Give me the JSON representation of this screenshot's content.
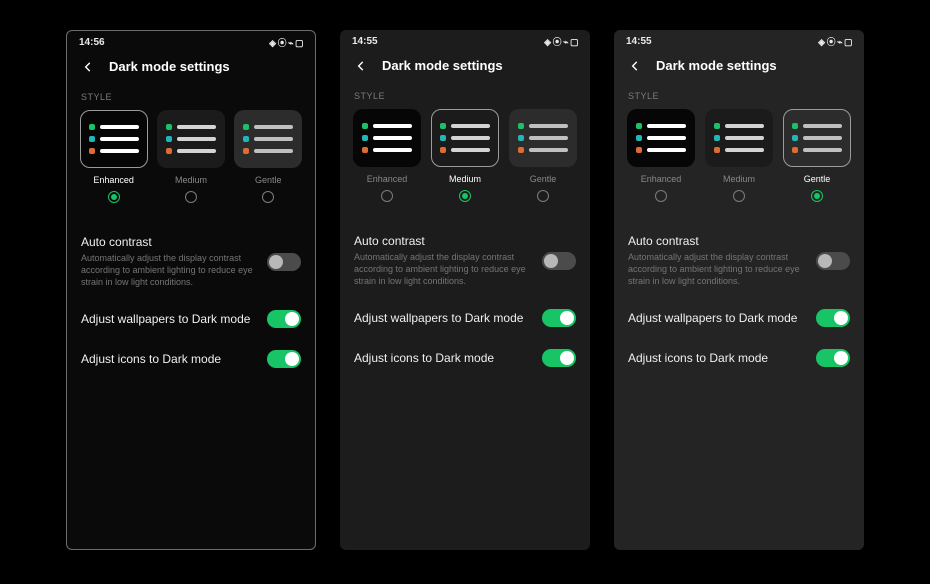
{
  "phones": [
    {
      "bg_class": "bg-enhanced",
      "framed": true,
      "time": "14:56",
      "title": "Dark mode settings",
      "section_label": "STYLE",
      "selected_index": 0,
      "styles": [
        {
          "label": "Enhanced"
        },
        {
          "label": "Medium"
        },
        {
          "label": "Gentle"
        }
      ],
      "settings": {
        "auto_contrast_title": "Auto contrast",
        "auto_contrast_sub": "Automatically adjust the display contrast according to ambient lighting to reduce eye strain in low light conditions.",
        "auto_contrast_on": false,
        "wallpapers_label": "Adjust wallpapers to Dark mode",
        "wallpapers_on": true,
        "icons_label": "Adjust icons to Dark mode",
        "icons_on": true
      }
    },
    {
      "bg_class": "bg-medium",
      "framed": false,
      "time": "14:55",
      "title": "Dark mode settings",
      "section_label": "STYLE",
      "selected_index": 1,
      "styles": [
        {
          "label": "Enhanced"
        },
        {
          "label": "Medium"
        },
        {
          "label": "Gentle"
        }
      ],
      "settings": {
        "auto_contrast_title": "Auto contrast",
        "auto_contrast_sub": "Automatically adjust the display contrast according to ambient lighting to reduce eye strain in low light conditions.",
        "auto_contrast_on": false,
        "wallpapers_label": "Adjust wallpapers to Dark mode",
        "wallpapers_on": true,
        "icons_label": "Adjust icons to Dark mode",
        "icons_on": true
      }
    },
    {
      "bg_class": "bg-gentle",
      "framed": false,
      "time": "14:55",
      "title": "Dark mode settings",
      "section_label": "STYLE",
      "selected_index": 2,
      "styles": [
        {
          "label": "Enhanced"
        },
        {
          "label": "Medium"
        },
        {
          "label": "Gentle"
        }
      ],
      "settings": {
        "auto_contrast_title": "Auto contrast",
        "auto_contrast_sub": "Automatically adjust the display contrast according to ambient lighting to reduce eye strain in low light conditions.",
        "auto_contrast_on": false,
        "wallpapers_label": "Adjust wallpapers to Dark mode",
        "wallpapers_on": true,
        "icons_label": "Adjust icons to Dark mode",
        "icons_on": true
      }
    }
  ]
}
